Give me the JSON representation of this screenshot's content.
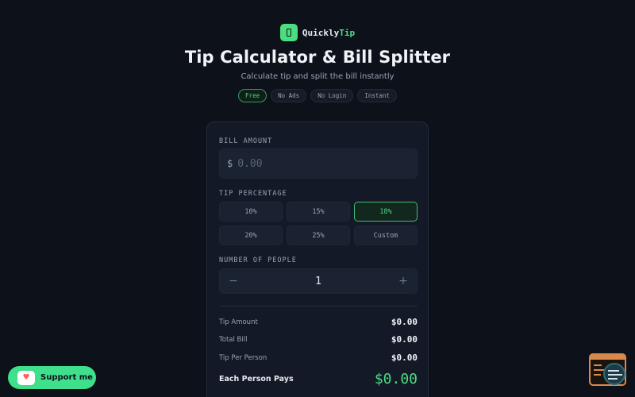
{
  "brand": {
    "name_main": "Quickly",
    "name_accent": "Tip"
  },
  "header": {
    "title": "Tip Calculator & Bill Splitter",
    "subtitle": "Calculate tip and split the bill instantly",
    "badges": [
      "Free",
      "No Ads",
      "No Login",
      "Instant"
    ]
  },
  "form": {
    "bill_label": "BILL AMOUNT",
    "currency": "$",
    "bill_placeholder": "0.00",
    "bill_value": "",
    "tip_label": "TIP PERCENTAGE",
    "tip_options": [
      "10%",
      "15%",
      "18%",
      "20%",
      "25%",
      "Custom"
    ],
    "tip_selected": "18%",
    "people_label": "NUMBER OF PEOPLE",
    "people_decrement": "−",
    "people_value": "1",
    "people_increment": "+"
  },
  "results": {
    "tip_amount_label": "Tip Amount",
    "tip_amount": "$0.00",
    "total_bill_label": "Total Bill",
    "total_bill": "$0.00",
    "tip_per_person_label": "Tip Per Person",
    "tip_per_person": "$0.00",
    "each_pays_label": "Each Person Pays",
    "each_pays": "$0.00"
  },
  "support": {
    "label": "Support me"
  },
  "colors": {
    "accent": "#4ade80",
    "background": "#0d111a",
    "card": "#141927"
  },
  "icons": {
    "brand": "receipt-icon",
    "support": "coffee-cup-icon",
    "widget": "browser-search-icon"
  }
}
